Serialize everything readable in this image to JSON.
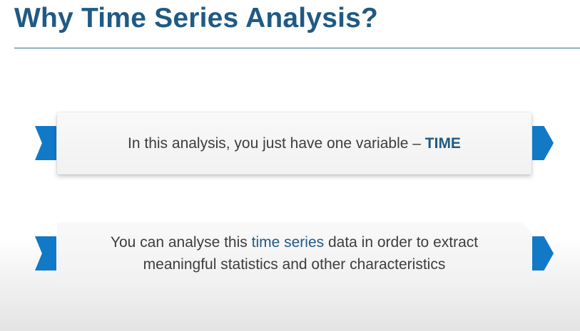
{
  "slide": {
    "title": "Why Time Series Analysis?"
  },
  "points": [
    {
      "text_before": "In this analysis, you just have one variable – ",
      "emphasis": "TIME",
      "text_after": ""
    },
    {
      "text_before": "You can analyse this ",
      "emphasis": "time series",
      "text_after": " data in order to extract meaningful statistics and other characteristics"
    }
  ],
  "colors": {
    "title": "#1f5a84",
    "accent": "#1279c6",
    "body_text": "#3d3d3d",
    "box_fill": "#f4f4f4"
  },
  "icons": {
    "ribbon_left": "chevron-ribbon-left",
    "ribbon_right": "chevron-ribbon-right"
  }
}
